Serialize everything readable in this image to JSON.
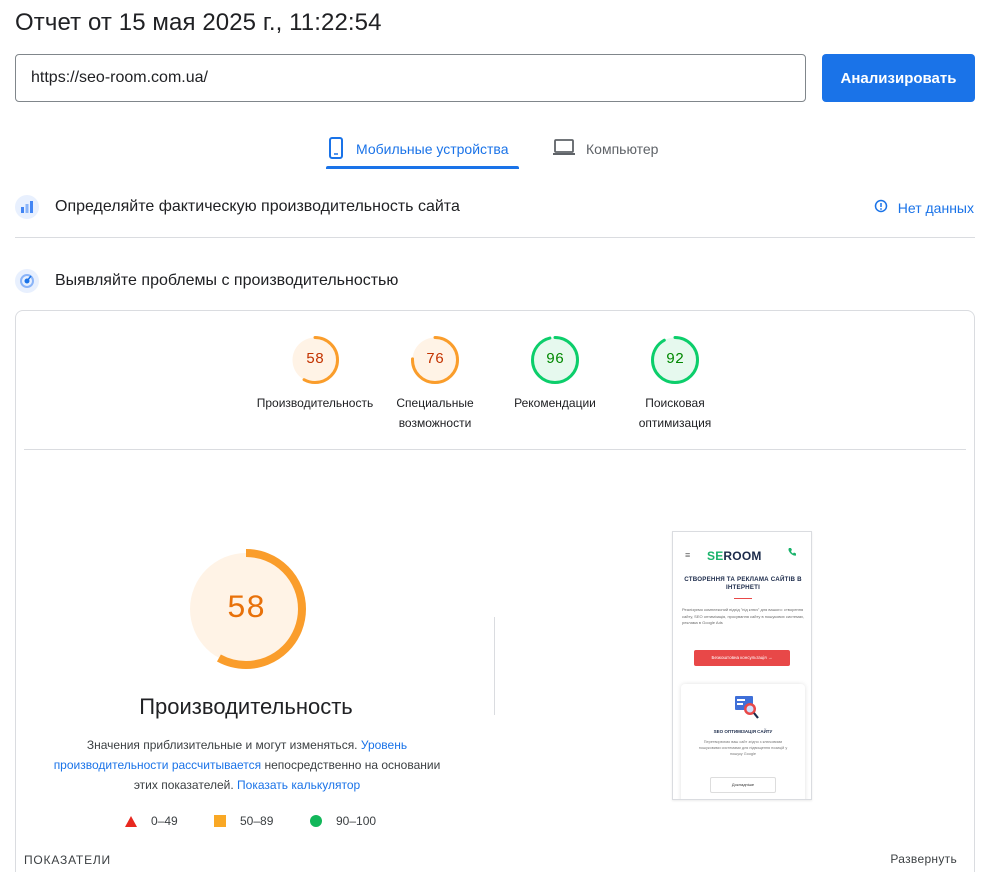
{
  "header": {
    "title": "Отчет от 15 мая 2025 г., 11:22:54",
    "url_value": "https://seo-room.com.ua/",
    "analyze_label": "Анализировать"
  },
  "tabs": [
    {
      "label": "Мобильные устройства",
      "icon": "smartphone-icon",
      "active": true
    },
    {
      "label": "Компьютер",
      "icon": "laptop-icon",
      "active": false
    }
  ],
  "field_section": {
    "title": "Определяйте фактическую производительность сайта",
    "no_data_label": "Нет данных"
  },
  "lab_section": {
    "title": "Выявляйте проблемы с производительностью"
  },
  "categories": [
    {
      "score": "58",
      "label": "Производительность",
      "status": "average"
    },
    {
      "score": "76",
      "label": "Специальные возможности",
      "status": "average"
    },
    {
      "score": "96",
      "label": "Рекомендации",
      "status": "pass"
    },
    {
      "score": "92",
      "label": "Поисковая оптимизация",
      "status": "pass"
    }
  ],
  "colors": {
    "accent": "#1a73e8",
    "average": "#fa9d2b",
    "average_text": "#c33300",
    "average_bg": "#fff3e6",
    "pass": "#0cce6b",
    "pass_text": "#008800",
    "pass_bg": "#e6f9ee",
    "fail": "#e8281f"
  },
  "performance": {
    "score": "58",
    "title": "Производительность",
    "desc_prefix": "Значения приблизительные и могут изменяться.",
    "desc_link1": "Уровень производительности рассчитывается",
    "desc_middle": "непосредственно на основании этих показателей.",
    "desc_link2": "Показать калькулятор"
  },
  "legend": [
    {
      "range": "0–49",
      "shape": "triangle"
    },
    {
      "range": "50–89",
      "shape": "square"
    },
    {
      "range": "90–100",
      "shape": "circle"
    }
  ],
  "screenshot": {
    "logo_part1": "SE",
    "logo_part2": "ROOM",
    "hero_title": "СТВОРЕННЯ ТА РЕКЛАМА САЙТІВ В ІНТЕРНЕТІ",
    "hero_text": "Реалізуємо комплексний підхід \"під ключ\" для вашого: створення сайту, SEO оптимізація, просування сайту в пошукових системах, реклама в Google Ads",
    "cta_label": "Безкоштовна консультація →",
    "card_title": "SEO ОПТИМІЗАЦІЯ САЙТУ",
    "card_text": "Перетворюємо ваш сайт згідно з ключовими пошуковими системами для підвищення позицій у пошуку Google",
    "card_button": "Докладніше"
  },
  "footer": {
    "metrics_label": "ПОКАЗАТЕЛИ",
    "expand_label": "Развернуть"
  }
}
